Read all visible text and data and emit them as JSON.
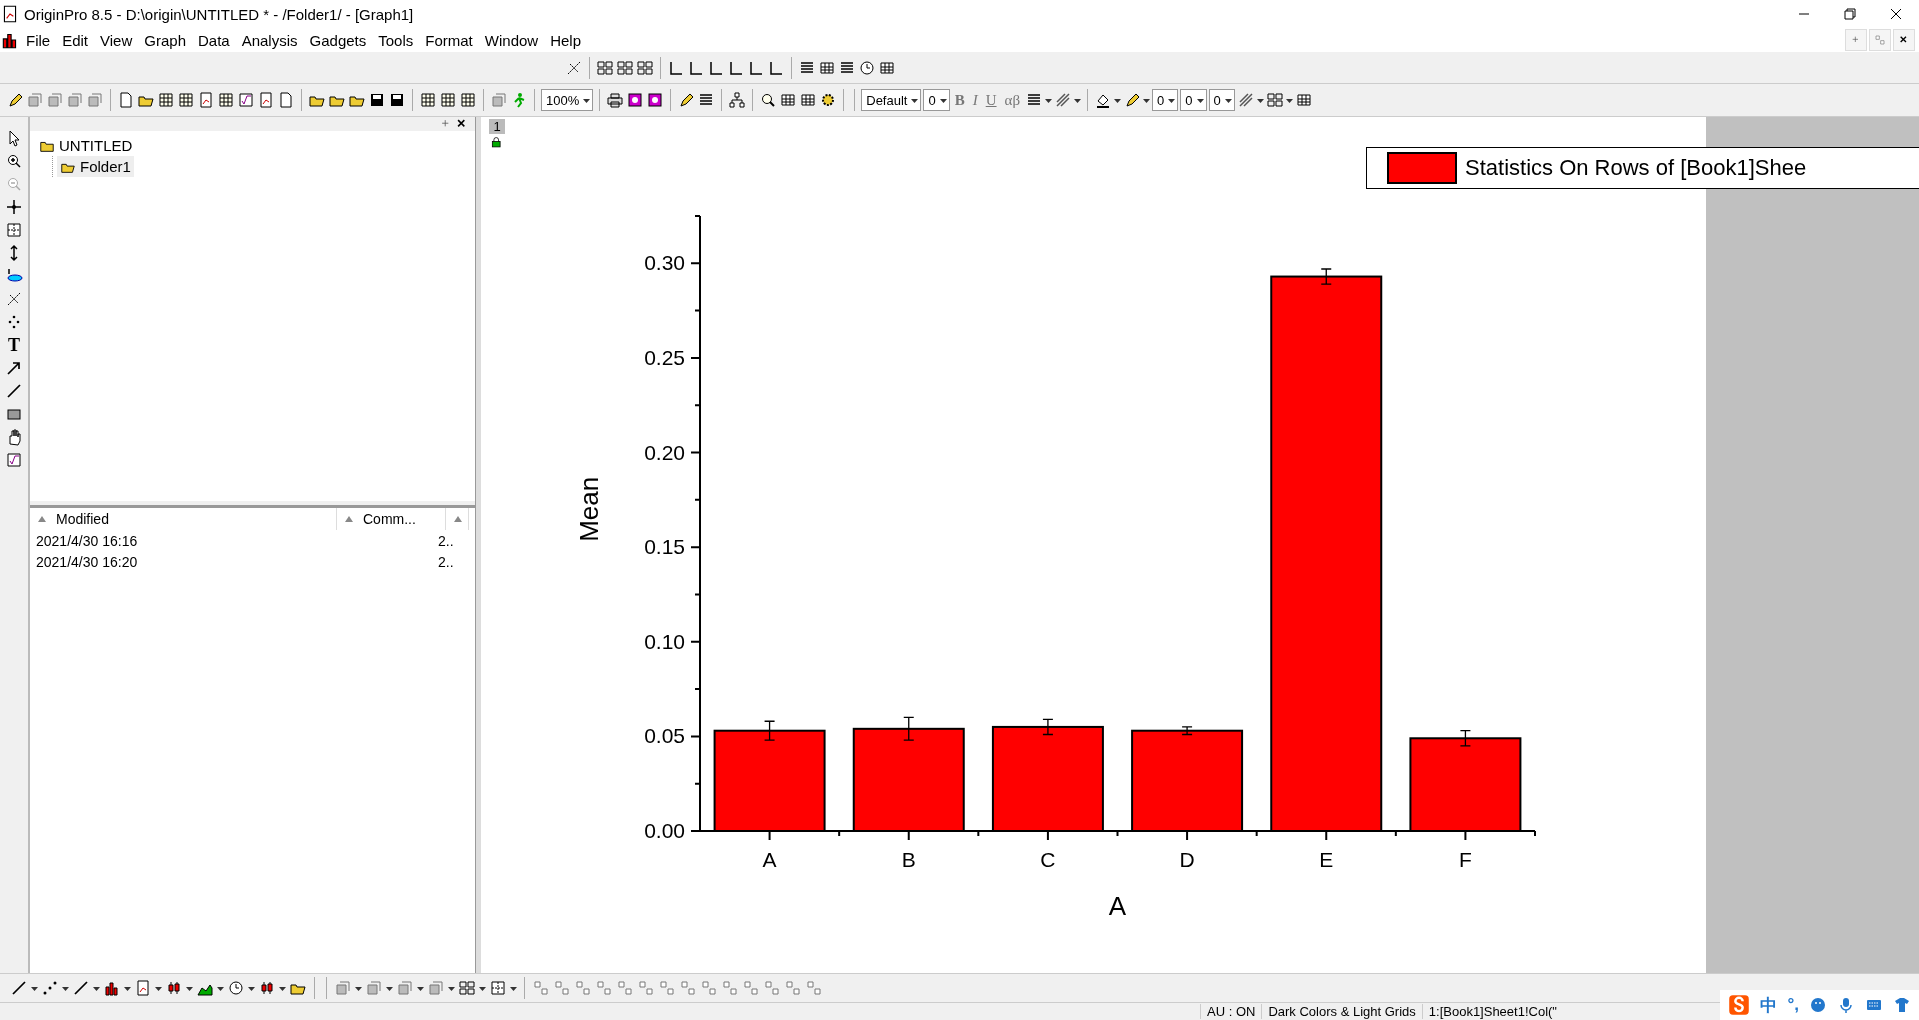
{
  "window": {
    "title": "OriginPro 8.5 - D:\\origin\\UNTITLED * - /Folder1/ - [Graph1]"
  },
  "menu": [
    "File",
    "Edit",
    "View",
    "Graph",
    "Data",
    "Analysis",
    "Gadgets",
    "Tools",
    "Format",
    "Window",
    "Help"
  ],
  "toolbar": {
    "zoom_combo": "100%",
    "font_combo": "Default",
    "font_size_combo": "0",
    "format_buttons": [
      "B",
      "I",
      "U"
    ],
    "greek_button": "αβ",
    "line_width_combos": [
      "0",
      "0",
      "0"
    ]
  },
  "draw_tools": {
    "text_tool": "T"
  },
  "project_explorer": {
    "tree": [
      {
        "label": "UNTITLED",
        "selected": false,
        "children": [
          {
            "label": "Folder1",
            "selected": true
          }
        ]
      }
    ],
    "columns": [
      "Modified",
      "Comm..."
    ],
    "rows": [
      {
        "modified": "2021/4/30 16:16",
        "column_3": "2.."
      },
      {
        "modified": "2021/4/30 16:20",
        "column_3": "2.."
      }
    ]
  },
  "graph": {
    "page_tab": "1",
    "chart_data": {
      "type": "bar",
      "xlabel": "A",
      "ylabel": "Mean",
      "categories": [
        "A",
        "B",
        "C",
        "D",
        "E",
        "F"
      ],
      "series": [
        {
          "name": "Statistics On Rows of [Book1]Shee",
          "color": "#ff0000",
          "values": [
            0.053,
            0.054,
            0.055,
            0.053,
            0.293,
            0.049
          ],
          "errors": [
            0.005,
            0.006,
            0.004,
            0.002,
            0.004,
            0.004
          ]
        }
      ],
      "ylim": [
        0,
        0.325
      ],
      "yticks": [
        {
          "value": 0,
          "label": "0.00"
        },
        {
          "value": 0.05,
          "label": "0.05"
        },
        {
          "value": 0.1,
          "label": "0.10"
        },
        {
          "value": 0.15,
          "label": "0.15"
        },
        {
          "value": 0.2,
          "label": "0.20"
        },
        {
          "value": 0.25,
          "label": "0.25"
        },
        {
          "value": 0.3,
          "label": "0.30"
        }
      ]
    }
  },
  "status_bar": [
    "AU : ON",
    "Dark Colors & Light Grids",
    "1:[Book1]Sheet1!Col(\""
  ],
  "ime_bar": {
    "mode": "中",
    "punctuation": "°,"
  }
}
